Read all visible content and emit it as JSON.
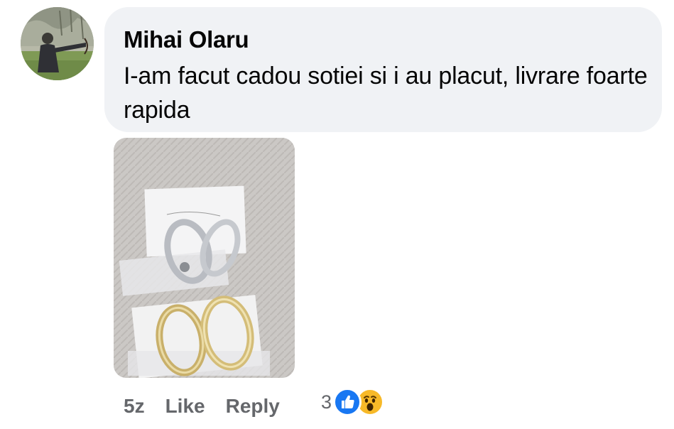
{
  "comment": {
    "author": "Mihai Olaru",
    "text": "I-am facut cadou sotiei si i au placut, livrare foarte rapida"
  },
  "actions": {
    "time": "5z",
    "like_label": "Like",
    "reply_label": "Reply"
  },
  "reactions": {
    "count": "3",
    "types": [
      "like-icon",
      "wow-icon"
    ]
  },
  "colors": {
    "bubble": "#f0f2f5",
    "action_text": "#65676b",
    "like_blue": "#1877f2",
    "wow_yellow": "#f7b928"
  }
}
